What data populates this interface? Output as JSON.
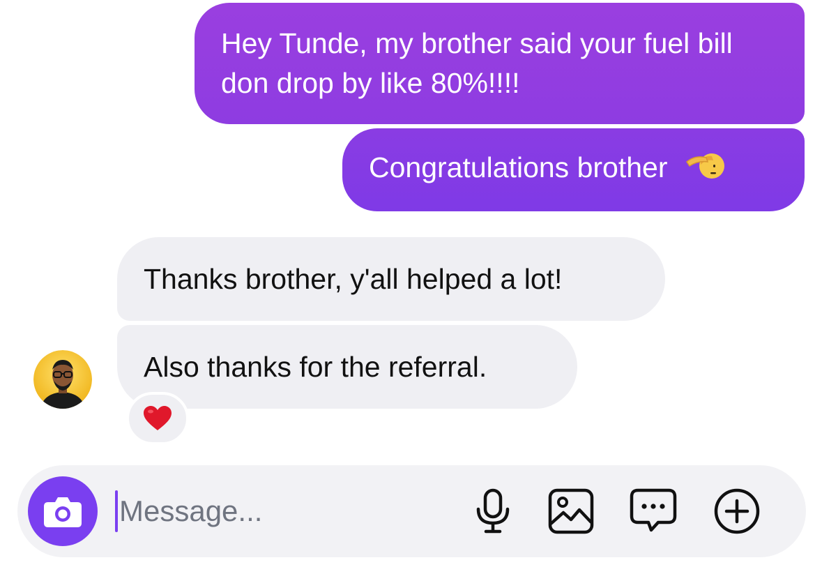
{
  "messages": {
    "outgoing": [
      {
        "text": "Hey Tunde, my brother said your fuel bill don drop by like 80%!!!!"
      },
      {
        "text": "Congratulations brother",
        "emoji_icon": "saluting-face-icon"
      }
    ],
    "incoming": [
      {
        "text": "Thanks brother, y'all helped a lot!"
      },
      {
        "text": "Also thanks for the referral.",
        "reaction_icon": "red-heart-icon"
      }
    ]
  },
  "composer": {
    "placeholder": "Message...",
    "value": "",
    "icons": [
      "camera-icon",
      "microphone-icon",
      "gallery-icon",
      "chat-bubble-icon",
      "add-icon"
    ]
  },
  "colors": {
    "outgoing_bubble": "#8e3ce1",
    "incoming_bubble": "#efeff3",
    "accent": "#7a3ff0"
  }
}
